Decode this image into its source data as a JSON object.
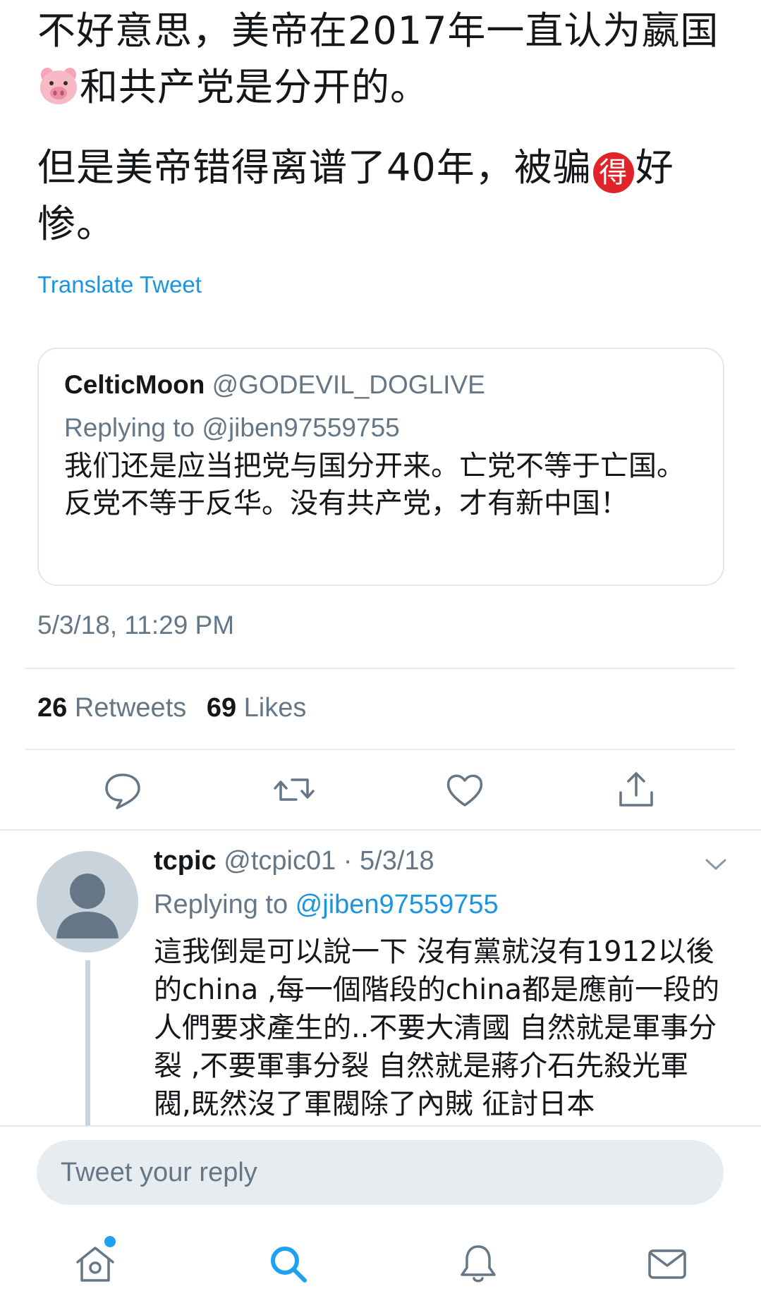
{
  "tweet": {
    "line1": "不好意思，美帝在2017年一直认为嬴国",
    "line1_after_emoji": "和共产党是分开的。",
    "para2_before": "但是美帝错得离谱了40年，被骗",
    "para2_badge": "得",
    "para2_after": "好惨。",
    "pig_emoji": "pig-face-emoji",
    "translate_label": "Translate Tweet",
    "timestamp": "5/3/18, 11:29 PM"
  },
  "quoted": {
    "name": "CelticMoon",
    "handle": "@GODEVIL_DOGLIVE",
    "replying": "Replying to @jiben97559755",
    "body": "我们还是应当把党与国分开来。亡党不等于亡国。反党不等于反华。没有共产党，才有新中国！"
  },
  "stats": {
    "retweets_count": "26",
    "retweets_label": "Retweets",
    "likes_count": "69",
    "likes_label": "Likes"
  },
  "actions": [
    "reply-icon",
    "retweet-icon",
    "like-icon",
    "share-icon"
  ],
  "reply": {
    "name": "tcpic",
    "handle_date": "@tcpic01 · 5/3/18",
    "replying_prefix": "Replying to ",
    "replying_handle": "@jiben97559755",
    "body": "這我倒是可以說一下 沒有黨就沒有1912以後的china ,每一個階段的china都是應前一段的人們要求產生的..不要大清國 自然就是軍事分裂 ,不要軍事分裂 自然就是蔣介石先殺光軍閥,既然沒了軍閥除了內賊 征討日本"
  },
  "composer": {
    "placeholder": "Tweet your reply"
  },
  "tabs": [
    "home-icon",
    "search-icon",
    "notifications-icon",
    "messages-icon"
  ],
  "colors": {
    "link": "#1b95e0",
    "secondary_text": "#657786",
    "active_tab": "#1da1f2"
  }
}
